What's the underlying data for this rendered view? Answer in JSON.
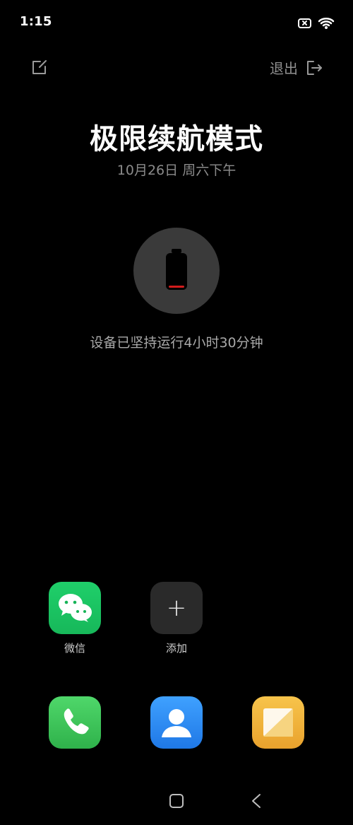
{
  "status": {
    "time": "1:15",
    "icons": [
      "battery-x-icon",
      "wifi-icon"
    ]
  },
  "header": {
    "edit_icon": "edit-icon",
    "exit_label": "退出",
    "exit_icon": "exit-icon"
  },
  "main": {
    "title": "极限续航模式",
    "date": "10月26日 周六下午",
    "battery_icon": "battery-low-icon",
    "runtime_text": "设备已坚持运行4小时30分钟"
  },
  "apps": [
    {
      "name": "微信",
      "icon": "wechat-icon",
      "color": "#1fcf6a"
    },
    {
      "name": "添加",
      "icon": "plus-icon",
      "color": "#2a2a2a"
    }
  ],
  "dock": [
    {
      "icon": "phone-icon",
      "color": "#2fb24b"
    },
    {
      "icon": "contacts-icon",
      "color": "#1f78e6"
    },
    {
      "icon": "notes-icon",
      "color": "#e9a22d"
    }
  ],
  "navbar": {
    "home_icon": "square-icon",
    "back_icon": "back-chevron-icon"
  },
  "colors": {
    "background": "#000000",
    "battery_circle": "#3a3a3a",
    "battery_low": "#d21c1c",
    "muted_text": "#8b8b8b"
  }
}
